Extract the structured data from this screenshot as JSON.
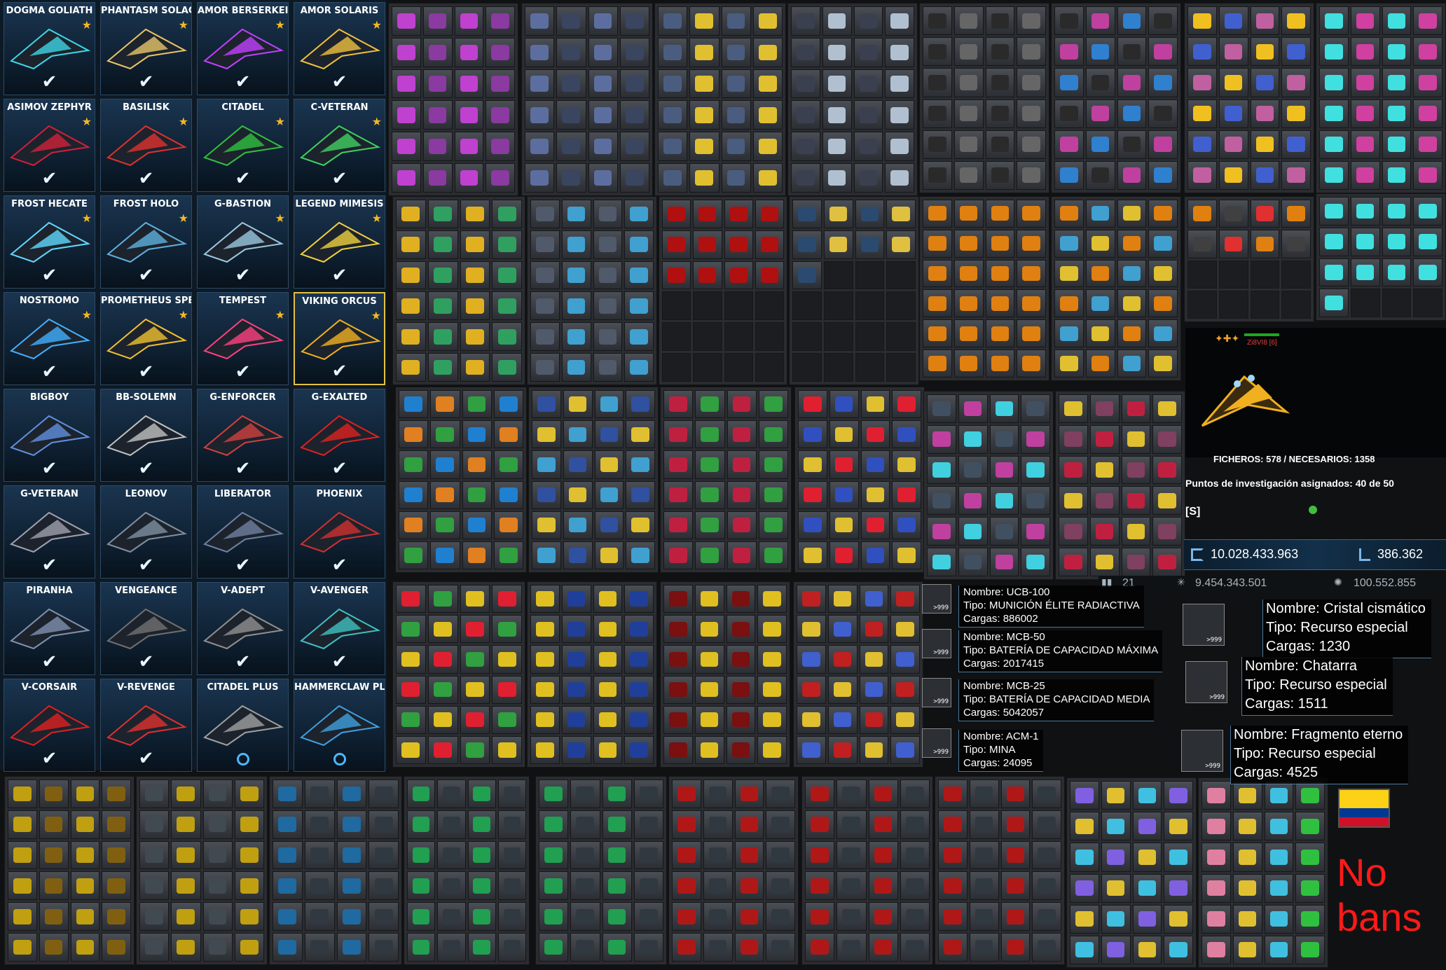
{
  "ships": [
    {
      "name": "DOGMA GOLIATH",
      "state": "check",
      "star": true,
      "color": "#3fd5e6"
    },
    {
      "name": "PHANTASM SOLAC",
      "state": "check",
      "star": true,
      "color": "#e8c46a"
    },
    {
      "name": "AMOR BERSERKEI",
      "state": "check",
      "star": true,
      "color": "#c040ff"
    },
    {
      "name": "AMOR SOLARIS",
      "state": "check",
      "star": true,
      "color": "#f0c040"
    },
    {
      "name": "ASIMOV ZEPHYR",
      "state": "check",
      "star": true,
      "color": "#d0203a"
    },
    {
      "name": "BASILISK",
      "state": "check",
      "star": true,
      "color": "#e03030"
    },
    {
      "name": "CITADEL",
      "state": "check",
      "star": true,
      "color": "#30c040"
    },
    {
      "name": "C-VETERAN",
      "state": "check",
      "star": true,
      "color": "#40d060"
    },
    {
      "name": "FROST HECATE",
      "state": "check",
      "star": true,
      "color": "#60d8ff"
    },
    {
      "name": "FROST HOLO",
      "state": "check",
      "star": true,
      "color": "#5fb0e0"
    },
    {
      "name": "G-BASTION",
      "state": "check",
      "star": true,
      "color": "#9ac8e0"
    },
    {
      "name": "LEGEND MIMESIS",
      "state": "check",
      "star": true,
      "color": "#f0d040"
    },
    {
      "name": "NOSTROMO",
      "state": "check",
      "star": true,
      "color": "#40b0ff"
    },
    {
      "name": "PROMETHEUS SPE",
      "state": "check",
      "star": true,
      "color": "#f0c030"
    },
    {
      "name": "TEMPEST",
      "state": "check",
      "star": true,
      "color": "#ff4080"
    },
    {
      "name": "VIKING ORCUS",
      "state": "check",
      "star": true,
      "color": "#f0b020",
      "selected": true
    },
    {
      "name": "BIGBOY",
      "state": "check",
      "star": false,
      "color": "#6090e0"
    },
    {
      "name": "BB-SOLEMN",
      "state": "check",
      "star": false,
      "color": "#c0c0c0"
    },
    {
      "name": "G-ENFORCER",
      "state": "check",
      "star": false,
      "color": "#d04040"
    },
    {
      "name": "G-EXALTED",
      "state": "check",
      "star": false,
      "color": "#e02020"
    },
    {
      "name": "G-VETERAN",
      "state": "check",
      "star": false,
      "color": "#a0a0b0"
    },
    {
      "name": "LEONOV",
      "state": "check",
      "star": false,
      "color": "#8090a0"
    },
    {
      "name": "LIBERATOR",
      "state": "check",
      "star": false,
      "color": "#7080a0"
    },
    {
      "name": "PHOENIX",
      "state": "check",
      "star": false,
      "color": "#d03030"
    },
    {
      "name": "PIRANHA",
      "state": "check",
      "star": false,
      "color": "#8090b0"
    },
    {
      "name": "VENGEANCE",
      "state": "check",
      "star": false,
      "color": "#707070"
    },
    {
      "name": "V-ADEPT",
      "state": "check",
      "star": false,
      "color": "#909090"
    },
    {
      "name": "V-AVENGER",
      "state": "check",
      "star": false,
      "color": "#40c0c0"
    },
    {
      "name": "V-CORSAIR",
      "state": "check",
      "star": false,
      "color": "#e02020"
    },
    {
      "name": "V-REVENGE",
      "state": "check",
      "star": false,
      "color": "#e03030"
    },
    {
      "name": "CITADEL PLUS",
      "state": "circle",
      "star": false,
      "color": "#a0a0a0"
    },
    {
      "name": "HAMMERCLAW PL",
      "state": "circle",
      "star": false,
      "color": "#40a0e0"
    }
  ],
  "research": {
    "player_label": "Zi8VI8 [6]",
    "files": "FICHEROS: 578 / NECESARIOS: 1358",
    "points": "Puntos de investigación asignados: 40 de 50",
    "name_tag": "[S] ",
    "credits": "10.028.433.963",
    "uridium": "386.362",
    "stat_a": "21",
    "stat_b": "9.454.343.501",
    "stat_c": "100.552.855"
  },
  "ammo_tooltips": [
    {
      "name": "Nombre: UCB-100",
      "type": "Tipo: MUNICIÓN ÉLITE RADIACTIVA",
      "charges": "Cargas: 886002",
      "qty": ">999"
    },
    {
      "name": "Nombre: MCB-50",
      "type": "Tipo: BATERÍA DE CAPACIDAD MÁXIMA",
      "charges": "Cargas: 2017415",
      "qty": ">999"
    },
    {
      "name": "Nombre: MCB-25",
      "type": "Tipo: BATERÍA DE CAPACIDAD MEDIA",
      "charges": "Cargas: 5042057",
      "qty": ">999"
    },
    {
      "name": "Nombre: ACM-1",
      "type": "Tipo: MINA",
      "charges": "Cargas: 24095",
      "qty": ">999"
    }
  ],
  "resource_tooltips": [
    {
      "name": "Nombre: Cristal cismático",
      "type": "Tipo: Recurso especial",
      "charges": "Cargas: 1230",
      "qty": ">999"
    },
    {
      "name": "Nombre: Chatarra",
      "type": "Tipo: Recurso especial",
      "charges": "Cargas: 1511",
      "qty": ">999"
    },
    {
      "name": "Nombre: Fragmento eterno",
      "type": "Tipo: Recurso especial",
      "charges": "Cargas: 4525",
      "qty": ">999"
    }
  ],
  "footer": {
    "no_bans": "No\nbans",
    "no_bans_color": "#ff1a1a"
  },
  "flag_colors": [
    "#fcd116",
    "#003893",
    "#ce1126"
  ],
  "accent_gold": "#e2c043",
  "accent_blue": "#4db7ff"
}
